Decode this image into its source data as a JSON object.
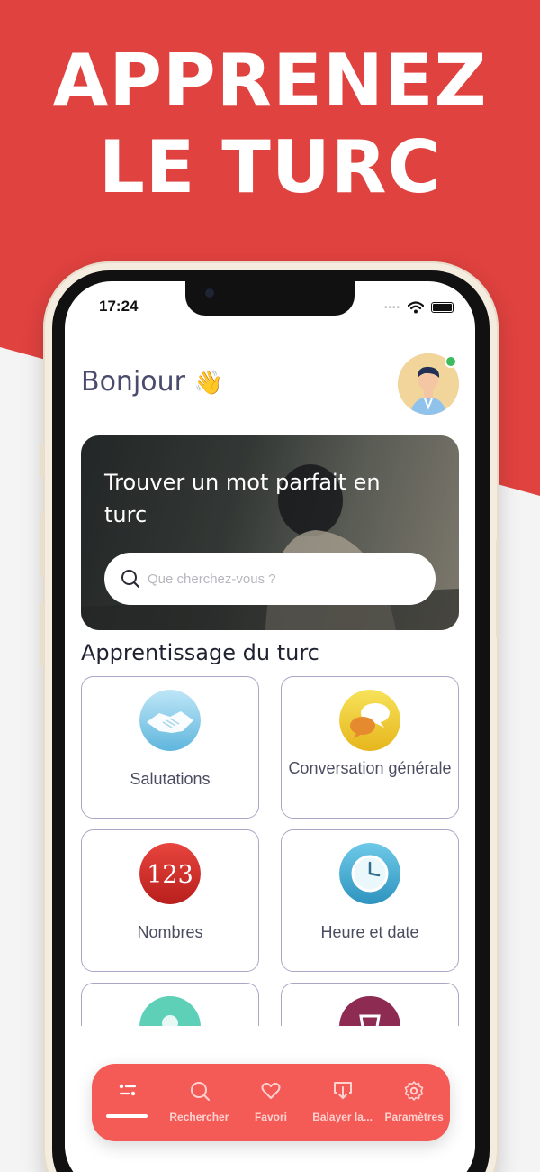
{
  "banner": {
    "line1": "APPRENEZ",
    "line2": "LE TURC"
  },
  "status_bar": {
    "time": "17:24"
  },
  "header": {
    "greeting": "Bonjour",
    "wave_emoji": "👋"
  },
  "hero": {
    "title": "Trouver un mot parfait en turc",
    "search_placeholder": "Que cherchez-vous ?"
  },
  "section": {
    "title": "Apprentissage du turc"
  },
  "categories": [
    {
      "label": "Salutations",
      "icon": "handshake-icon"
    },
    {
      "label": "Conversation générale",
      "icon": "speech-bubbles-icon"
    },
    {
      "label": "Nombres",
      "icon": "numbers-icon",
      "icon_text": "123"
    },
    {
      "label": "Heure et date",
      "icon": "clock-icon"
    }
  ],
  "tabbar": {
    "tabs": [
      {
        "label": "",
        "icon": "home-list-icon",
        "active": true
      },
      {
        "label": "Rechercher",
        "icon": "search-icon"
      },
      {
        "label": "Favori",
        "icon": "heart-icon"
      },
      {
        "label": "Balayer la...",
        "icon": "swipe-download-icon"
      },
      {
        "label": "Paramètres",
        "icon": "gear-icon"
      }
    ]
  },
  "colors": {
    "brand_red": "#e0423f",
    "tabbar_red": "#f45b57",
    "text_dark": "#1f2230",
    "card_border": "#a8a8c6",
    "online_green": "#3dbb5d"
  }
}
